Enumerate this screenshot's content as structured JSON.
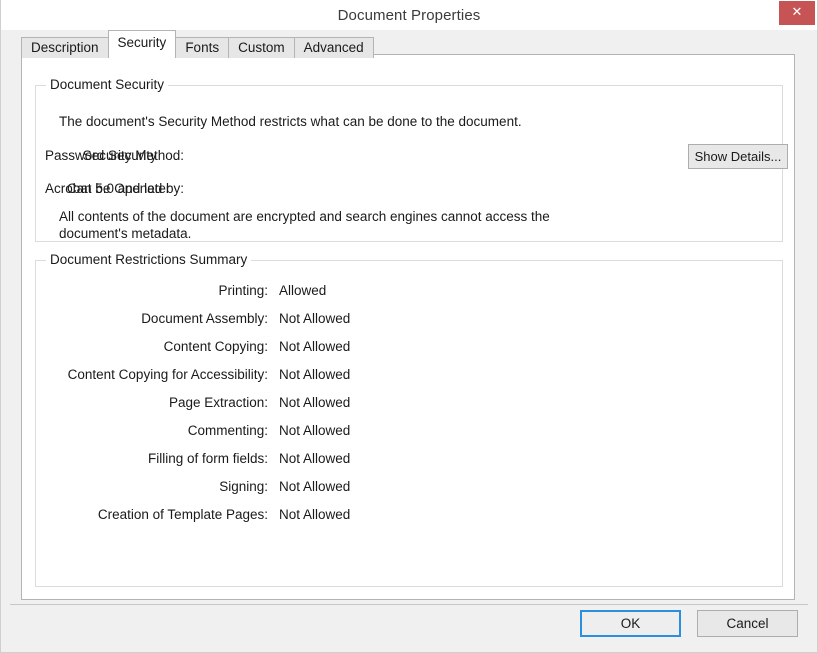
{
  "window": {
    "title": "Document Properties",
    "close_label": "✕",
    "close_icon": "close-icon",
    "accent_blue": "#2b8fe0",
    "close_red": "#c75454"
  },
  "tabs": [
    {
      "label": "Description",
      "selected": false
    },
    {
      "label": "Security",
      "selected": true
    },
    {
      "label": "Fonts",
      "selected": false
    },
    {
      "label": "Custom",
      "selected": false
    },
    {
      "label": "Advanced",
      "selected": false
    }
  ],
  "security_group": {
    "title": "Document Security",
    "intro": "The document's Security Method restricts what can be done to the document.",
    "rows": [
      {
        "label": "Security Method:",
        "value": "Password Security"
      },
      {
        "label": "Can be Opened by:",
        "value": "Acrobat 5.0 and later"
      }
    ],
    "encryption_note": "All contents of the document are encrypted and search engines cannot access the document's metadata.",
    "show_details_label": "Show Details..."
  },
  "restrictions_group": {
    "title": "Document Restrictions Summary",
    "rows": [
      {
        "label": "Printing:",
        "value": "Allowed"
      },
      {
        "label": "Document Assembly:",
        "value": "Not Allowed"
      },
      {
        "label": "Content Copying:",
        "value": "Not Allowed"
      },
      {
        "label": "Content Copying for Accessibility:",
        "value": "Not Allowed"
      },
      {
        "label": "Page Extraction:",
        "value": "Not Allowed"
      },
      {
        "label": "Commenting:",
        "value": "Not Allowed"
      },
      {
        "label": "Filling of form fields:",
        "value": "Not Allowed"
      },
      {
        "label": "Signing:",
        "value": "Not Allowed"
      },
      {
        "label": "Creation of Template Pages:",
        "value": "Not Allowed"
      }
    ]
  },
  "footer": {
    "ok_label": "OK",
    "cancel_label": "Cancel"
  }
}
